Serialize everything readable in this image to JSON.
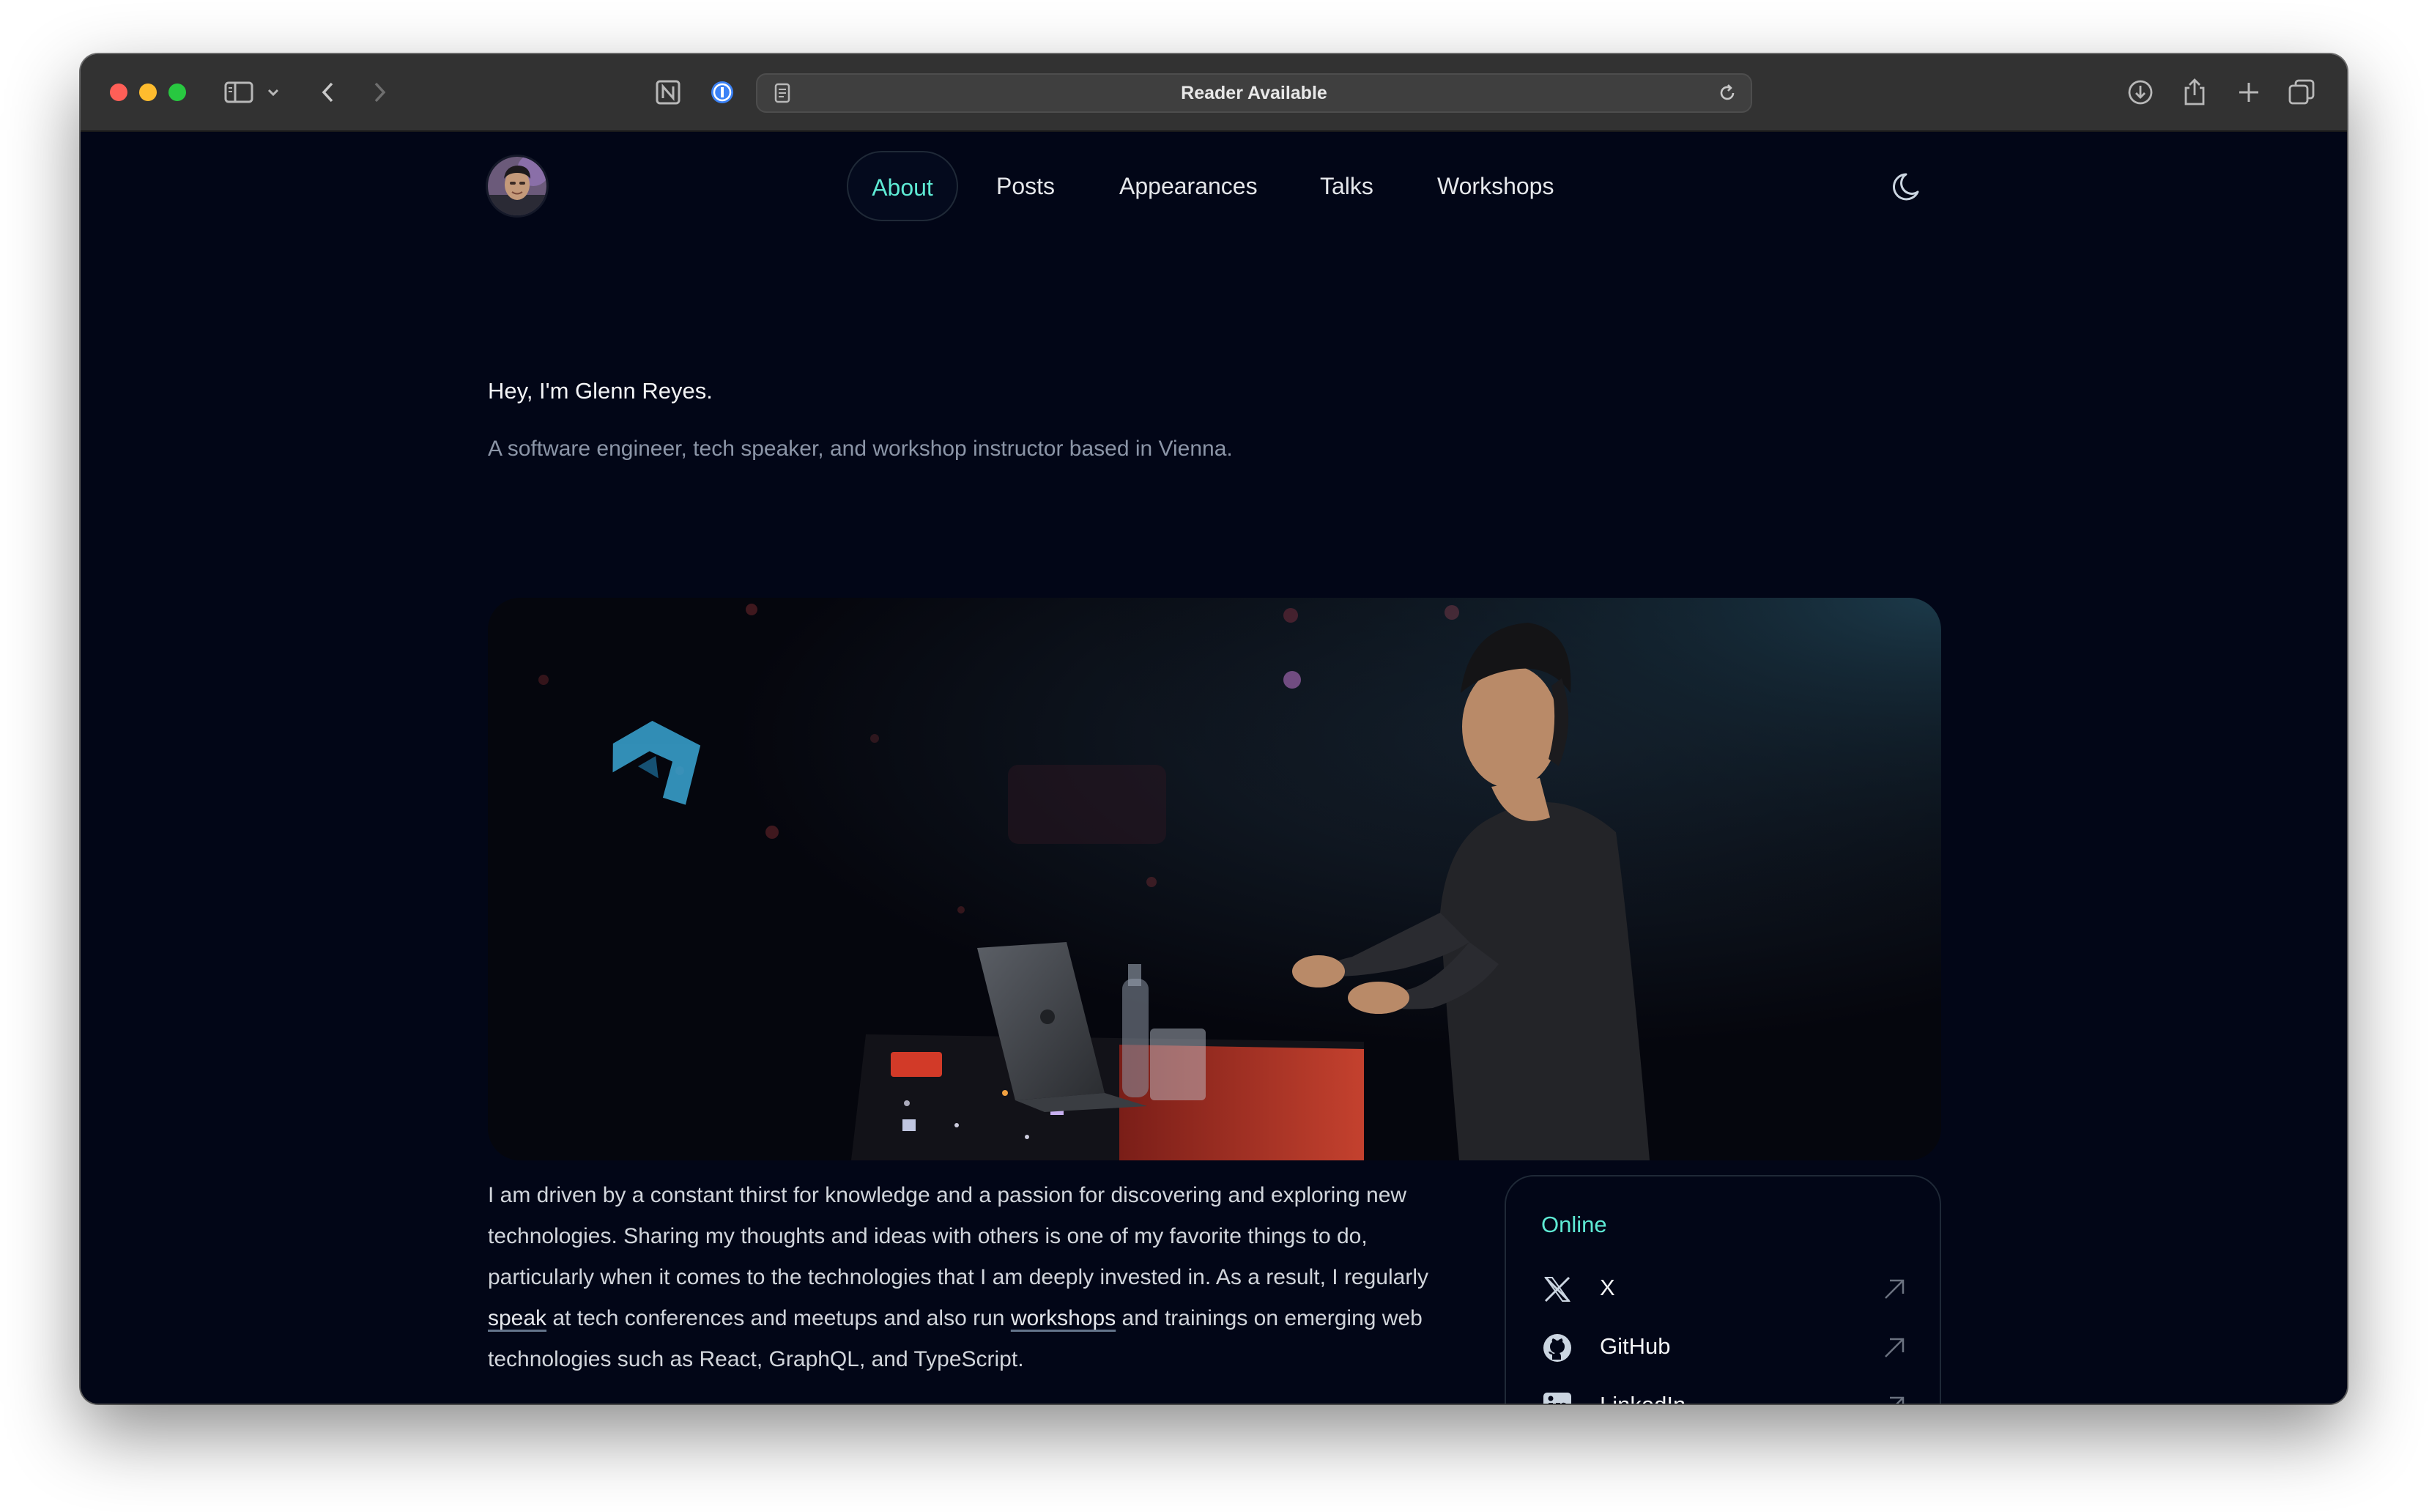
{
  "browser": {
    "url_text": "Reader Available"
  },
  "nav": {
    "items": [
      {
        "label": "About",
        "active": true
      },
      {
        "label": "Posts"
      },
      {
        "label": "Appearances"
      },
      {
        "label": "Talks"
      },
      {
        "label": "Workshops"
      }
    ]
  },
  "intro": {
    "greeting": "Hey, I'm Glenn Reyes.",
    "tagline": "A software engineer, tech speaker, and workshop instructor based in Vienna."
  },
  "bio": {
    "part1": "I am driven by a constant thirst for knowledge and a passion for discovering and exploring new technologies. Sharing my thoughts and ideas with others is one of my favorite things to do, particularly when it comes to the technologies that I am deeply invested in. As a result, I regularly ",
    "speak_link": "speak",
    "part2": " at tech conferences and meetups and also run ",
    "workshops_link": "workshops",
    "part3": " and trainings on emerging web technologies such as React, GraphQL, and TypeScript."
  },
  "online": {
    "title": "Online",
    "links": [
      {
        "label": "X",
        "icon": "x-logo-icon"
      },
      {
        "label": "GitHub",
        "icon": "github-icon"
      },
      {
        "label": "LinkedIn",
        "icon": "linkedin-icon"
      }
    ]
  },
  "colors": {
    "background": "#020617",
    "accent": "#5eead4",
    "text": "#e5e7eb",
    "muted": "#8b95a7"
  }
}
